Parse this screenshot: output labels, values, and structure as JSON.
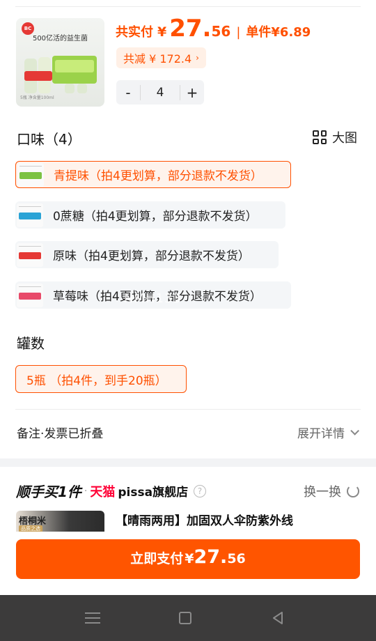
{
  "product": {
    "thumb_logo": "BC",
    "thumb_caption": "500亿活的益生菌",
    "thumb_foot": "5瓶 净含量100ml"
  },
  "price": {
    "total_label": "共实付",
    "currency": "¥",
    "total_int": "27.",
    "total_dec": "56",
    "separator": "|",
    "unit_text": "单件¥6.89"
  },
  "discount": {
    "text": "共减 ¥ 172.4",
    "chevron": "›"
  },
  "quantity": {
    "minus": "-",
    "value": "4",
    "plus": "+"
  },
  "flavor": {
    "title": "口味（4）",
    "big_view_label": "大图",
    "big_view_icon": "grid-icon",
    "options": [
      {
        "label": "青提味（拍4更划算，部分退款不发货）",
        "selected": true,
        "color": "#7cc242"
      },
      {
        "label": "0蔗糖（拍4更划算，部分退款不发货）",
        "selected": false,
        "color": "#2aa3d6"
      },
      {
        "label": "原味（拍4更划算，部分退款不发货）",
        "selected": false,
        "color": "#e53935"
      },
      {
        "label": "草莓味（拍4更划算，部分退款不发货）",
        "selected": false,
        "color": "#e84a6a"
      }
    ]
  },
  "bottles": {
    "title": "罐数",
    "option_label": "5瓶 （拍4件，到手20瓶）"
  },
  "notes": {
    "label": "备注·发票已折叠",
    "expand_label": "展开详情"
  },
  "recommend": {
    "title": "顺手买1件",
    "dot": "·",
    "platform": "天猫",
    "store": "pissa旗舰店",
    "help": "?",
    "refresh_label": "换一换",
    "item_brand": "梧桐米",
    "item_tag": "品质之选",
    "item_name": "【晴雨两用】加固双人伞防紫外线"
  },
  "pay": {
    "label": "立即支付",
    "currency": "¥",
    "amount_int": "27.",
    "amount_dec": "56"
  },
  "watermark": "NMH133",
  "colors": {
    "accent": "#ff5000",
    "accent_bg": "#fff3ec",
    "pay_button": "#ff5500",
    "nav_bar": "#3c3b3b"
  }
}
